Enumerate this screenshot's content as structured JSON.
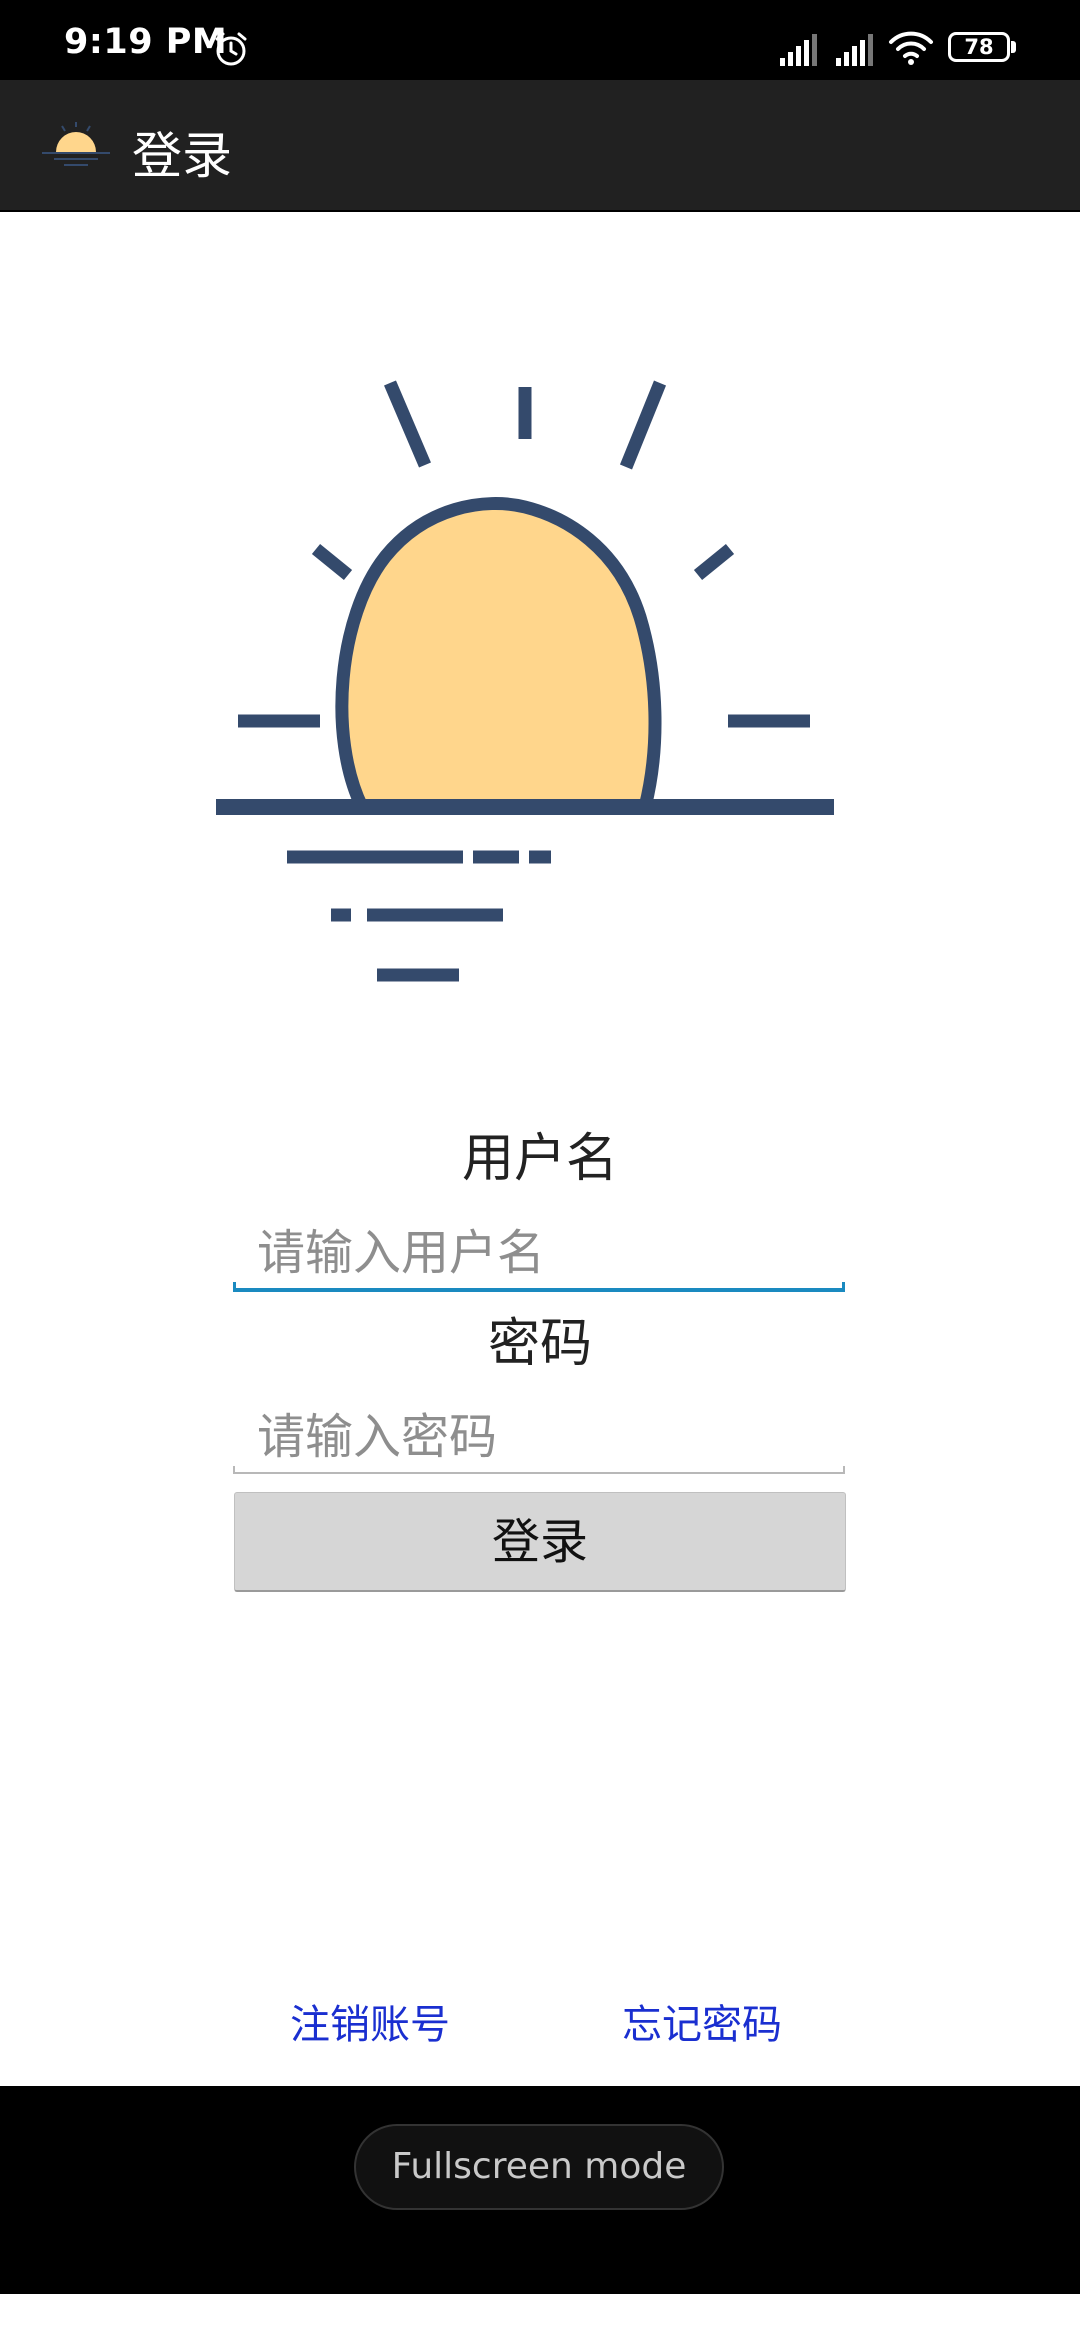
{
  "status_bar": {
    "time": "9:19 PM",
    "battery_level": "78",
    "icons": [
      "alarm-icon",
      "signal-icon",
      "signal-icon",
      "wifi-icon",
      "battery-icon"
    ]
  },
  "app_bar": {
    "title": "登录",
    "icon": "sunrise-icon"
  },
  "logo": {
    "icon": "sunrise-logo",
    "colors": {
      "sun": "#FFD68C",
      "stroke": "#344A6C"
    }
  },
  "form": {
    "username_label": "用户名",
    "username_placeholder": "请输入用户名",
    "username_value": "",
    "password_label": "密码",
    "password_placeholder": "请输入密码",
    "password_value": "",
    "login_button": "登录"
  },
  "links": {
    "deactivate_account": "注销账号",
    "forgot_password": "忘记密码"
  },
  "system": {
    "fullscreen_mode": "Fullscreen mode"
  },
  "colors": {
    "accent": "#1A8AC0",
    "link": "#1A2FD0",
    "app_bar": "#212121"
  }
}
